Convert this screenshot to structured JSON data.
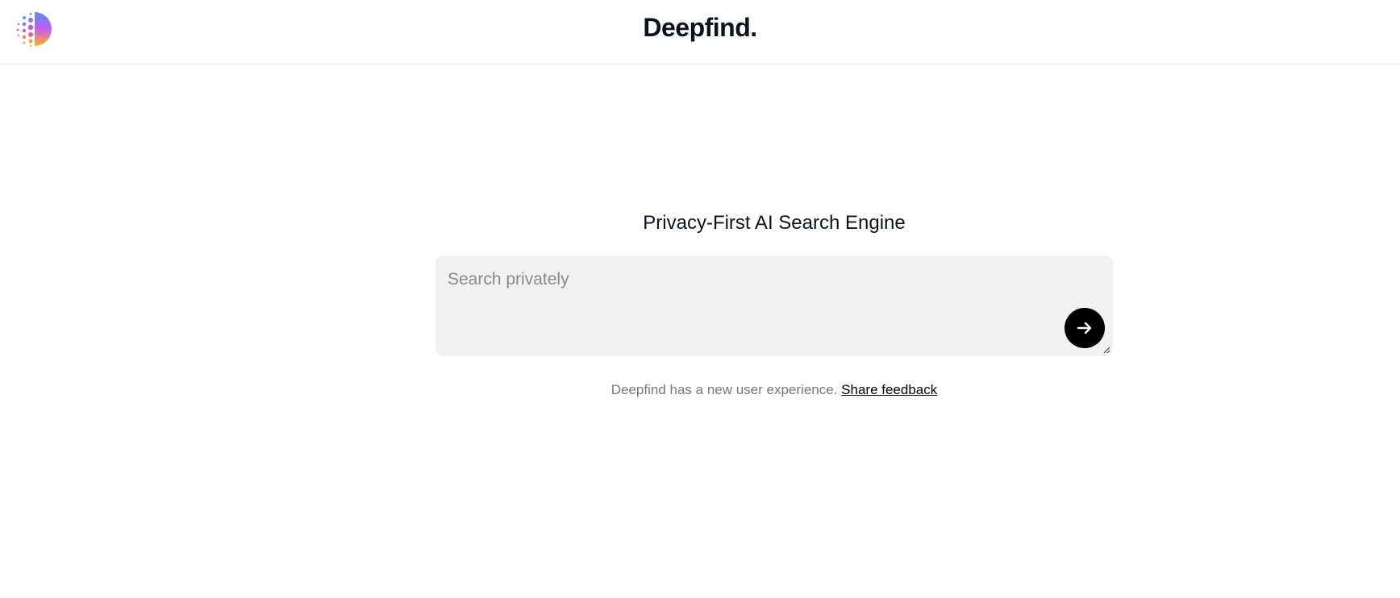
{
  "header": {
    "brand": "Deepfind.",
    "logo_icon": "deepfind-logo-icon"
  },
  "main": {
    "title": "Privacy-First AI Search Engine",
    "search": {
      "placeholder": "Search privately",
      "value": "",
      "submit_icon": "arrow-right-icon"
    },
    "notice": {
      "text": "Deepfind has a new user experience.",
      "link_label": "Share feedback"
    }
  },
  "colors": {
    "accent": "#000000",
    "input_bg": "#f1f1f1",
    "text": "#0d1220",
    "muted": "#777777"
  }
}
